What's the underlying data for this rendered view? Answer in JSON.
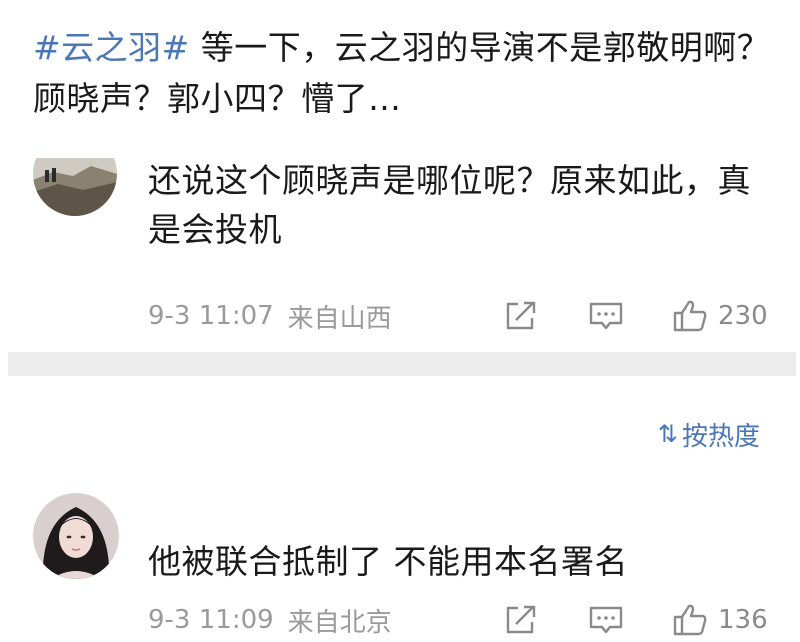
{
  "post": {
    "hashtag": "#云之羽#",
    "text": " 等一下，云之羽的导演不是郭敬明啊？顾晓声？郭小四？懵了…"
  },
  "comments": [
    {
      "text": "还说这个顾晓声是哪位呢？原来如此，真是会投机",
      "time": "9-3 11:07",
      "location": "来自山西",
      "likes": "230",
      "avatar": "landscape-avatar"
    },
    {
      "text": "他被联合抵制了 不能用本名署名",
      "time": "9-3 11:09",
      "location": "来自北京",
      "likes": "136",
      "avatar": "portrait-avatar"
    }
  ],
  "sort": {
    "icon": "⇅",
    "label": "按热度"
  },
  "colors": {
    "link": "#4b77b7",
    "meta": "#9a9a9a",
    "divider": "#ececec"
  }
}
